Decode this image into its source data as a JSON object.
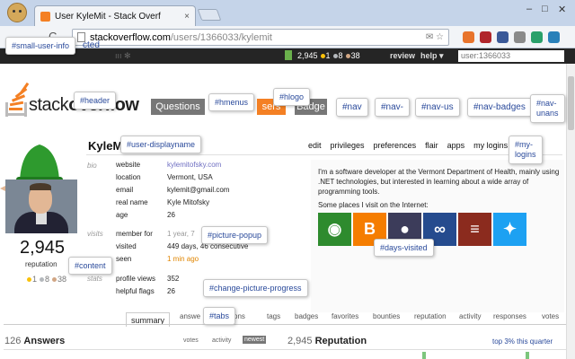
{
  "browser": {
    "tab_title": "User KyleMit - Stack Overf",
    "tab_close": "×",
    "win_min": "–",
    "win_max": "□",
    "win_close": "✕",
    "back": "←",
    "forward": "→",
    "reload": "C",
    "url_host": "stackoverflow.com",
    "url_path": "/users/1366033/kylemit",
    "omni_icons": "✉ ☆",
    "extension_colors": [
      "#e8742c",
      "#b0262b",
      "#3b5998",
      "#8a8a8a",
      "#2aa06a",
      "#2980b9"
    ]
  },
  "topbar": {
    "rep": "2,945",
    "gold": "1",
    "silver": "8",
    "bronze": "38",
    "review": "review",
    "help": "help ▾",
    "search_value": "user:1366033",
    "dim_icons": "ııı   ✻"
  },
  "header": {
    "logo_prefix": "stack",
    "logo_bold": "overflow",
    "menu_questions": "Questions",
    "menu_users": "sers",
    "menu_badges": "Badge"
  },
  "tooltips": {
    "small_user_info": "#small-user-info",
    "small_user_info_tail": "cted",
    "header": "#header",
    "hmenus": "#hmenus",
    "hlogo": "#hlogo",
    "nav1": "#nav",
    "nav2": "#nav-",
    "nav_users": "#nav-us",
    "nav_badges": "#nav-badges",
    "nav_unanswered_1": "#nav-",
    "nav_unanswered_2": "unans",
    "user_displayname": "#user-displayname",
    "my_logins_1": "#my-",
    "my_logins_2": "logins",
    "picture_popup": "#picture-popup",
    "content": "#content",
    "days_visited": "#days-visited",
    "change_picture_progress": "#change-picture-progress",
    "tabs": "#tabs"
  },
  "user": {
    "display_name": "KyleMi",
    "links": [
      "edit",
      "privileges",
      "preferences",
      "flair",
      "apps",
      "my logins",
      "|"
    ],
    "reputation": "2,945",
    "reputation_label": "reputation",
    "badge_gold": "1",
    "badge_silver": "8",
    "badge_bronze": "38",
    "bio_label": "bio",
    "visits_label": "visits",
    "stats_label": "stats",
    "bio": [
      {
        "key": "website",
        "value": "kylemitofsky.com"
      },
      {
        "key": "location",
        "value": "Vermont, USA"
      },
      {
        "key": "email",
        "value": "kylemit@gmail.com"
      },
      {
        "key": "real name",
        "value": "Kyle Mitofsky"
      },
      {
        "key": "age",
        "value": "26"
      }
    ],
    "visits": [
      {
        "key": "member for",
        "value": "1 year, 7"
      },
      {
        "key": "visited",
        "value": "449 days, 46 consecutive"
      },
      {
        "key": "seen",
        "value": "1 min ago"
      }
    ],
    "stats": [
      {
        "key": "profile views",
        "value": "352"
      },
      {
        "key": "helpful flags",
        "value": "26"
      }
    ],
    "about_1": "I'm a software developer at the Vermont Department of Health, mainly using",
    "about_2": ".NET technologies, but interested in learning about a wide array of",
    "about_3": "programming tools.",
    "about_4": "Some places I visit on the Internet:",
    "services": [
      {
        "name": "globe",
        "color": "#2e8b2e",
        "glyph": "◉"
      },
      {
        "name": "blogger",
        "color": "#f57d00",
        "glyph": "B"
      },
      {
        "name": "github",
        "color": "#3c3c5a",
        "glyph": "●"
      },
      {
        "name": "infinity",
        "color": "#254b8e",
        "glyph": "∞"
      },
      {
        "name": "stackexchange",
        "color": "#8b2b1e",
        "glyph": "≡"
      },
      {
        "name": "twitter",
        "color": "#1da1f2",
        "glyph": "✦"
      }
    ]
  },
  "tabs": {
    "summary": "summary",
    "answers": "answe",
    "questions": "ons",
    "tags": "tags",
    "badges": "badges",
    "favorites": "favorites",
    "bounties": "bounties",
    "reputation": "reputation",
    "activity": "activity",
    "responses": "responses",
    "votes": "votes"
  },
  "answers": {
    "count": "126",
    "title": "Answers",
    "sort_votes": "votes",
    "sort_activity": "activity",
    "sort_newest": "newest"
  },
  "reputation_section": {
    "value": "2,945",
    "title": "Reputation",
    "top_pct": "top 3% this quarter"
  }
}
